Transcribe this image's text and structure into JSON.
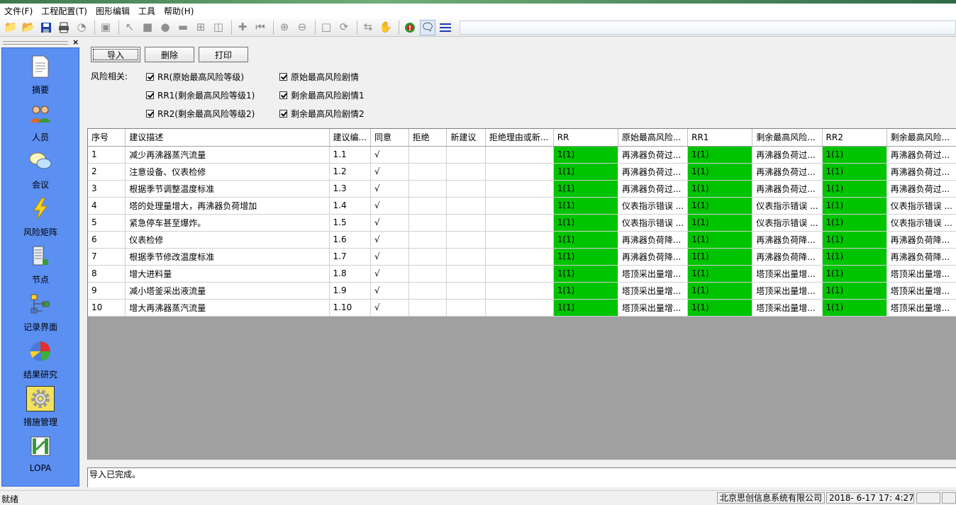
{
  "menu": [
    "文件(F)",
    "工程配置(T)",
    "图形编辑",
    "工具",
    "帮助(H)"
  ],
  "toolbar_icons": [
    "new-folder-icon",
    "open-folder-icon",
    "save-icon",
    "print-icon",
    "pie-icon",
    "folder-icon",
    "pointer-icon",
    "rectangle-icon",
    "circle-icon",
    "block-icon",
    "flowchart-icon",
    "trash-icon",
    "puzzle-icon",
    "first-icon",
    "zoom-in-icon",
    "zoom-out-icon",
    "page-icon",
    "refresh-icon",
    "sync-icon",
    "hand-icon",
    "alert-icon",
    "chat-icon",
    "list-icon"
  ],
  "sidebar": {
    "close": "×",
    "items": [
      {
        "label": "摘要",
        "icon": "document-icon"
      },
      {
        "label": "人员",
        "icon": "people-icon"
      },
      {
        "label": "会议",
        "icon": "meeting-icon"
      },
      {
        "label": "风险矩阵",
        "icon": "lightning-icon"
      },
      {
        "label": "节点",
        "icon": "node-icon"
      },
      {
        "label": "记录界面",
        "icon": "record-icon"
      },
      {
        "label": "结果研究",
        "icon": "pie-chart-icon"
      },
      {
        "label": "措施管理",
        "icon": "gear-icon"
      },
      {
        "label": "LOPA",
        "icon": "lopa-icon"
      }
    ]
  },
  "buttons": {
    "import": "导入",
    "delete": "删除",
    "print": "打印"
  },
  "risk": {
    "label": "风险相关:",
    "options": [
      "RR(原始最高风险等级)",
      "原始最高风险剧情",
      "RR1(剩余最高风险等级1)",
      "剩余最高风险剧情1",
      "RR2(剩余最高风险等级2)",
      "剩余最高风险剧情2"
    ]
  },
  "table": {
    "headers": [
      "序号",
      "建议描述",
      "建议编...",
      "同意",
      "拒绝",
      "新建议",
      "拒绝理由或新...",
      "RR",
      "原始最高风险...",
      "RR1",
      "剩余最高风险...",
      "RR2",
      "剩余最高风险..."
    ],
    "rows": [
      [
        "1",
        "减少再沸器蒸汽流量",
        "1.1",
        "√",
        "",
        "",
        "",
        "1(1)",
        "再沸器负荷过...",
        "1(1)",
        "再沸器负荷过...",
        "1(1)",
        "再沸器负荷过..."
      ],
      [
        "2",
        "注意设备、仪表检修",
        "1.2",
        "√",
        "",
        "",
        "",
        "1(1)",
        "再沸器负荷过...",
        "1(1)",
        "再沸器负荷过...",
        "1(1)",
        "再沸器负荷过..."
      ],
      [
        "3",
        "根据季节调整温度标准",
        "1.3",
        "√",
        "",
        "",
        "",
        "1(1)",
        "再沸器负荷过...",
        "1(1)",
        "再沸器负荷过...",
        "1(1)",
        "再沸器负荷过..."
      ],
      [
        "4",
        "塔的处理量增大，再沸器负荷增加",
        "1.4",
        "√",
        "",
        "",
        "",
        "1(1)",
        "仪表指示错误 ...",
        "1(1)",
        "仪表指示错误 ...",
        "1(1)",
        "仪表指示错误 ..."
      ],
      [
        "5",
        "紧急停车甚至爆炸。",
        "1.5",
        "√",
        "",
        "",
        "",
        "1(1)",
        "仪表指示错误 ...",
        "1(1)",
        "仪表指示错误 ...",
        "1(1)",
        "仪表指示错误 ..."
      ],
      [
        "6",
        "仪表检修",
        "1.6",
        "√",
        "",
        "",
        "",
        "1(1)",
        "再沸器负荷降...",
        "1(1)",
        "再沸器负荷降...",
        "1(1)",
        "再沸器负荷降..."
      ],
      [
        "7",
        "根据季节修改温度标准",
        "1.7",
        "√",
        "",
        "",
        "",
        "1(1)",
        "再沸器负荷降...",
        "1(1)",
        "再沸器负荷降...",
        "1(1)",
        "再沸器负荷降..."
      ],
      [
        "8",
        "增大进料量",
        "1.8",
        "√",
        "",
        "",
        "",
        "1(1)",
        "塔顶采出量增...",
        "1(1)",
        "塔顶采出量增...",
        "1(1)",
        "塔顶采出量增..."
      ],
      [
        "9",
        "减小塔釜采出液流量",
        "1.9",
        "√",
        "",
        "",
        "",
        "1(1)",
        "塔顶采出量增...",
        "1(1)",
        "塔顶采出量增...",
        "1(1)",
        "塔顶采出量增..."
      ],
      [
        "10",
        "增大再沸器蒸汽流量",
        "1.10",
        "√",
        "",
        "",
        "",
        "1(1)",
        "塔顶采出量增...",
        "1(1)",
        "塔顶采出量增...",
        "1(1)",
        "塔顶采出量增..."
      ]
    ]
  },
  "message": "导入已完成。",
  "statusbar": {
    "ready": "就绪",
    "company": "北京思创信息系统有限公司",
    "datetime": "2018- 6-17 17: 4:27"
  },
  "colors": {
    "sidebar": "#5b8ff2",
    "risk_green": "#00c400",
    "selected_item": "#f3e25b"
  }
}
